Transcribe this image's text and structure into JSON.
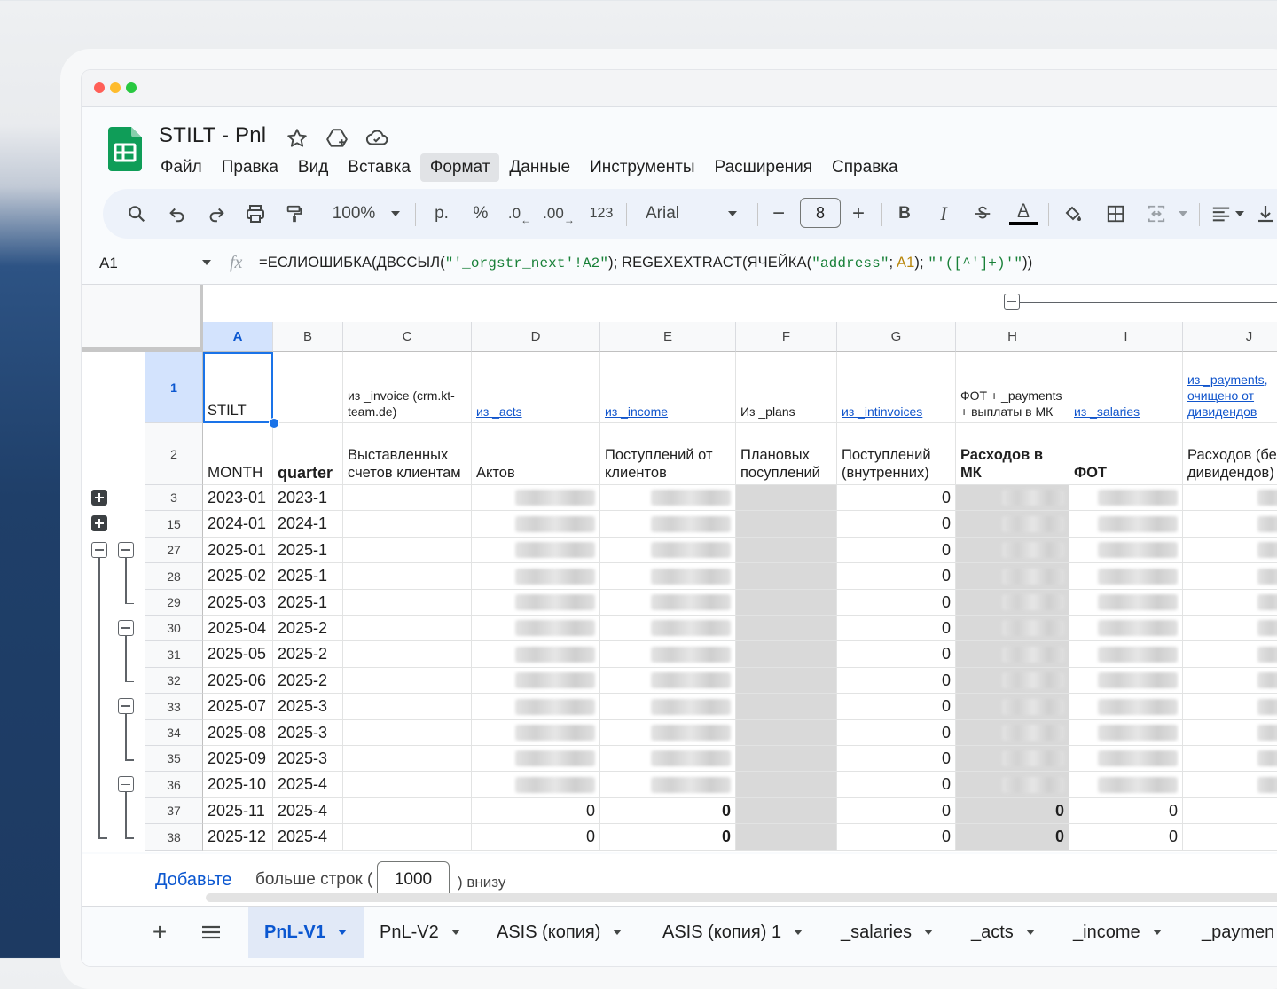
{
  "window": {
    "traffic_lights": [
      "#ff5f57",
      "#febc2e",
      "#28c840"
    ]
  },
  "doc": {
    "title": "STILT - Pnl"
  },
  "menu": [
    "Файл",
    "Правка",
    "Вид",
    "Вставка",
    "Формат",
    "Данные",
    "Инструменты",
    "Расширения",
    "Справка"
  ],
  "toolbar": {
    "zoom": "100%",
    "currency": "р.",
    "percent": "%",
    "dec_decrease": ".0",
    "dec_increase": ".00",
    "number_format": "123",
    "font": "Arial",
    "font_size": "8",
    "minus": "−",
    "plus": "+",
    "bold": "B",
    "italic": "I",
    "text_color": "A"
  },
  "formula_bar": {
    "cell_ref": "A1",
    "fx": "fx",
    "p1": "=ЕСЛИОШИБКА(ДВССЫЛ(",
    "s1": "\"'_orgstr_next'!A2\"",
    "p2": "); REGEXEXTRACT(ЯЧЕЙКА(",
    "s2": "\"address\"",
    "p3": "; ",
    "ref": "A1",
    "p4": "); ",
    "s3": "\"'([^']+)'\"",
    "p5": "))"
  },
  "columns": [
    "A",
    "B",
    "C",
    "D",
    "E",
    "F",
    "G",
    "H",
    "I",
    "J"
  ],
  "header_row1": {
    "A": "STILT",
    "C": "из _invoice (crm.kt-team.de)",
    "D": "из _acts",
    "E": "из _income",
    "F": "Из _plans",
    "G": "из _intinvoices",
    "H": "ФОТ + _payments + выплаты в МК",
    "I": "из _salaries",
    "J": "из _payments, очищено от дивидендов"
  },
  "header_row2": {
    "A": "MONTH",
    "B": "quarter",
    "C": "Выставленных счетов клиентам",
    "D": "Актов",
    "E": "Поступлений от клиентов",
    "F": "Плановых посуплений",
    "G": "Поступлений (внутренних)",
    "H": "Расходов в МК",
    "I": "ФОТ",
    "J": "Расходов (бе дивидендов)"
  },
  "rows": [
    {
      "num": "3",
      "month": "2023-01",
      "quarter": "2023-1",
      "g": "0"
    },
    {
      "num": "15",
      "month": "2024-01",
      "quarter": "2024-1",
      "g": "0"
    },
    {
      "num": "27",
      "month": "2025-01",
      "quarter": "2025-1",
      "g": "0"
    },
    {
      "num": "28",
      "month": "2025-02",
      "quarter": "2025-1",
      "g": "0"
    },
    {
      "num": "29",
      "month": "2025-03",
      "quarter": "2025-1",
      "g": "0"
    },
    {
      "num": "30",
      "month": "2025-04",
      "quarter": "2025-2",
      "g": "0"
    },
    {
      "num": "31",
      "month": "2025-05",
      "quarter": "2025-2",
      "g": "0"
    },
    {
      "num": "32",
      "month": "2025-06",
      "quarter": "2025-2",
      "g": "0"
    },
    {
      "num": "33",
      "month": "2025-07",
      "quarter": "2025-3",
      "g": "0"
    },
    {
      "num": "34",
      "month": "2025-08",
      "quarter": "2025-3",
      "g": "0"
    },
    {
      "num": "35",
      "month": "2025-09",
      "quarter": "2025-3",
      "g": "0"
    },
    {
      "num": "36",
      "month": "2025-10",
      "quarter": "2025-4",
      "g": "0"
    },
    {
      "num": "37",
      "month": "2025-11",
      "quarter": "2025-4",
      "d": "0",
      "e": "0",
      "g": "0",
      "h": "0",
      "i": "0"
    },
    {
      "num": "38",
      "month": "2025-12",
      "quarter": "2025-4",
      "d": "0",
      "e": "0",
      "g": "0",
      "h": "0",
      "i": "0"
    }
  ],
  "add_rows": {
    "link": "Добавьте",
    "text1": "больше строк (",
    "value": "1000",
    "text2": ") внизу"
  },
  "tabs": [
    "PnL-V1",
    "PnL-V2",
    "ASIS (копия)",
    "ASIS (копия) 1",
    "_salaries",
    "_acts",
    "_income",
    "_paymen"
  ]
}
